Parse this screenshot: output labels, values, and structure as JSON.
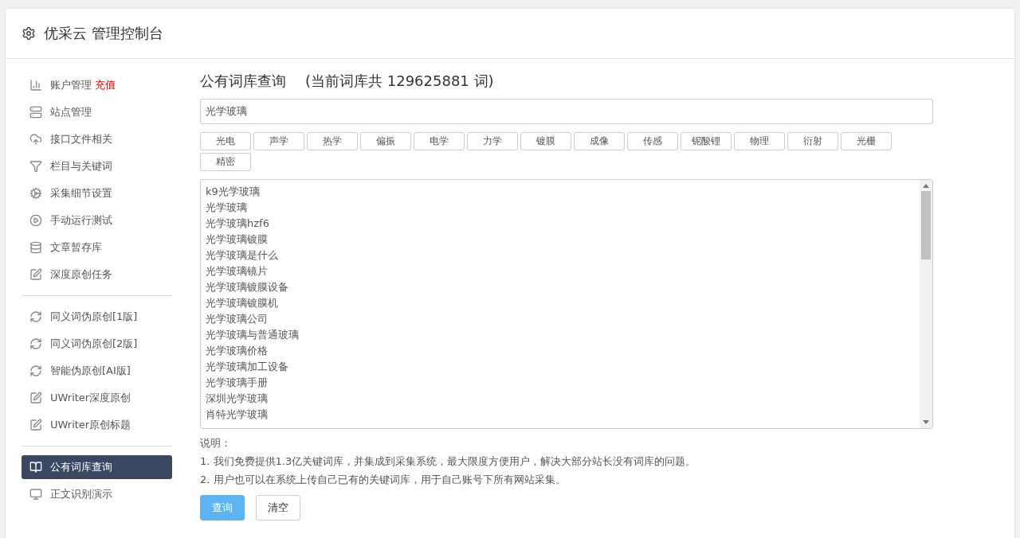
{
  "header": {
    "title": "优采云 管理控制台"
  },
  "sidebar": {
    "groups": [
      [
        {
          "label": "账户管理",
          "badge": "充值",
          "selected": false
        },
        {
          "label": "站点管理",
          "selected": false
        },
        {
          "label": "接口文件相关",
          "selected": false
        },
        {
          "label": "栏目与关键词",
          "selected": false
        },
        {
          "label": "采集细节设置",
          "selected": false
        },
        {
          "label": "手动运行测试",
          "selected": false
        },
        {
          "label": "文章暂存库",
          "selected": false
        },
        {
          "label": "深度原创任务",
          "selected": false
        }
      ],
      [
        {
          "label": "同义词伪原创[1版]",
          "selected": false
        },
        {
          "label": "同义词伪原创[2版]",
          "selected": false
        },
        {
          "label": "智能伪原创[AI版]",
          "selected": false
        },
        {
          "label": "UWriter深度原创",
          "selected": false
        },
        {
          "label": "UWriter原创标题",
          "selected": false
        }
      ],
      [
        {
          "label": "公有词库查询",
          "selected": true
        },
        {
          "label": "正文识别演示",
          "selected": false
        }
      ]
    ]
  },
  "main": {
    "title": "公有词库查询",
    "count_note": "(当前词库共 129625881 词)",
    "search": {
      "value": "光学玻璃"
    },
    "tags": [
      "光电",
      "声学",
      "热学",
      "偏振",
      "电学",
      "力学",
      "镀膜",
      "成像",
      "传感",
      "铌酸锂",
      "物理",
      "衍射",
      "光栅",
      "精密"
    ],
    "results": [
      "k9光学玻璃",
      "光学玻璃",
      "光学玻璃hzf6",
      "光学玻璃镀膜",
      "光学玻璃是什么",
      "光学玻璃镜片",
      "光学玻璃镀膜设备",
      "光学玻璃镀膜机",
      "光学玻璃公司",
      "光学玻璃与普通玻璃",
      "光学玻璃价格",
      "光学玻璃加工设备",
      "光学玻璃手册",
      "深圳光学玻璃",
      "肖特光学玻璃"
    ],
    "notes_title": "说明：",
    "notes": [
      "1. 我们免费提供1.3亿关键词库，并集成到采集系统，最大限度方便用户，解决大部分站长没有词库的问题。",
      "2. 用户也可以在系统上传自己已有的关键词库，用于自己账号下所有网站采集。"
    ],
    "buttons": [
      {
        "label": "查询",
        "kind": "primary"
      },
      {
        "label": "清空",
        "kind": "default"
      }
    ]
  }
}
